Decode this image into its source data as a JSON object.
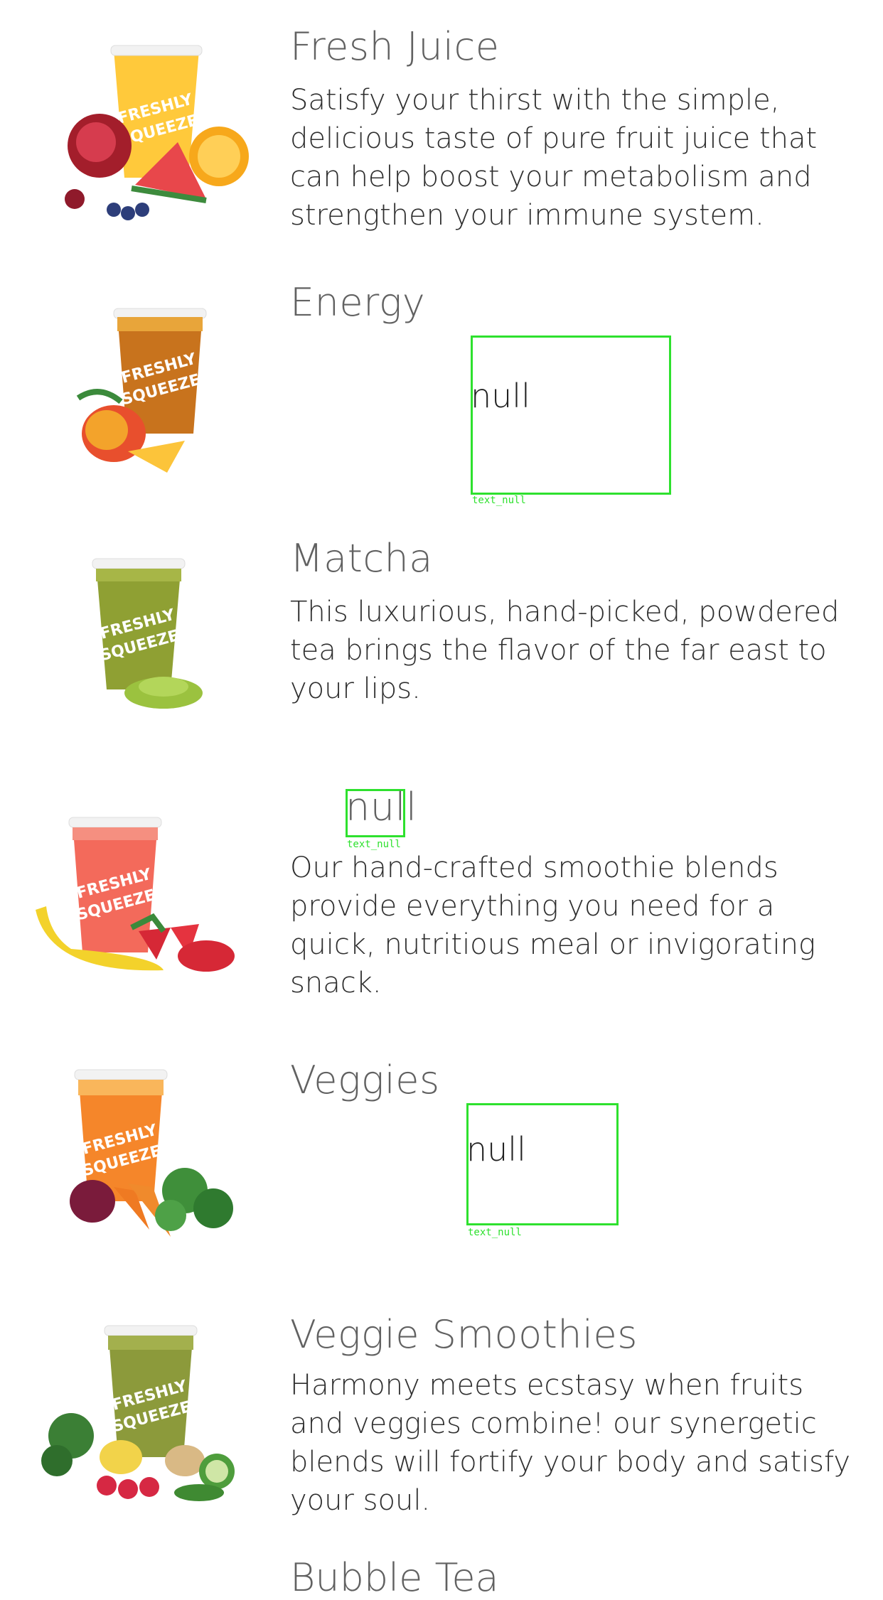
{
  "items": [
    {
      "title": "Fresh Juice",
      "desc": "Satisfy your thirst with the simple, delicious taste of pure fruit juice that can help boost your metabolism and strengthen your immune system.",
      "image_icon": "juice-cup-with-fruits-icon"
    },
    {
      "title": "Energy",
      "desc_null": "null",
      "debug_caption": "text_null",
      "image_icon": "mango-drink-icon"
    },
    {
      "title": "Matcha",
      "desc": "This luxurious, hand-picked, powdered tea brings the flavor of the far east to your lips.",
      "image_icon": "matcha-drink-icon"
    },
    {
      "title_null": "null",
      "debug_caption": "text_null",
      "desc": "Our hand-crafted smoothie blends provide everything you need for a quick, nutritious meal or invigorating snack.",
      "image_icon": "strawberry-banana-smoothie-icon"
    },
    {
      "title": "Veggies",
      "desc_null": "null",
      "debug_caption": "text_null",
      "image_icon": "carrot-juice-icon"
    },
    {
      "title": "Veggie Smoothies",
      "desc": "Harmony meets ecstasy when fruits and veggies combine! our synergetic blends will fortify your body and satisfy your soul.",
      "image_icon": "green-smoothie-icon"
    }
  ],
  "next_title_partial": "Bubble Tea",
  "colors": {
    "overlay": "#2ee12e",
    "title": "#616161",
    "text": "#2f2f2f"
  }
}
